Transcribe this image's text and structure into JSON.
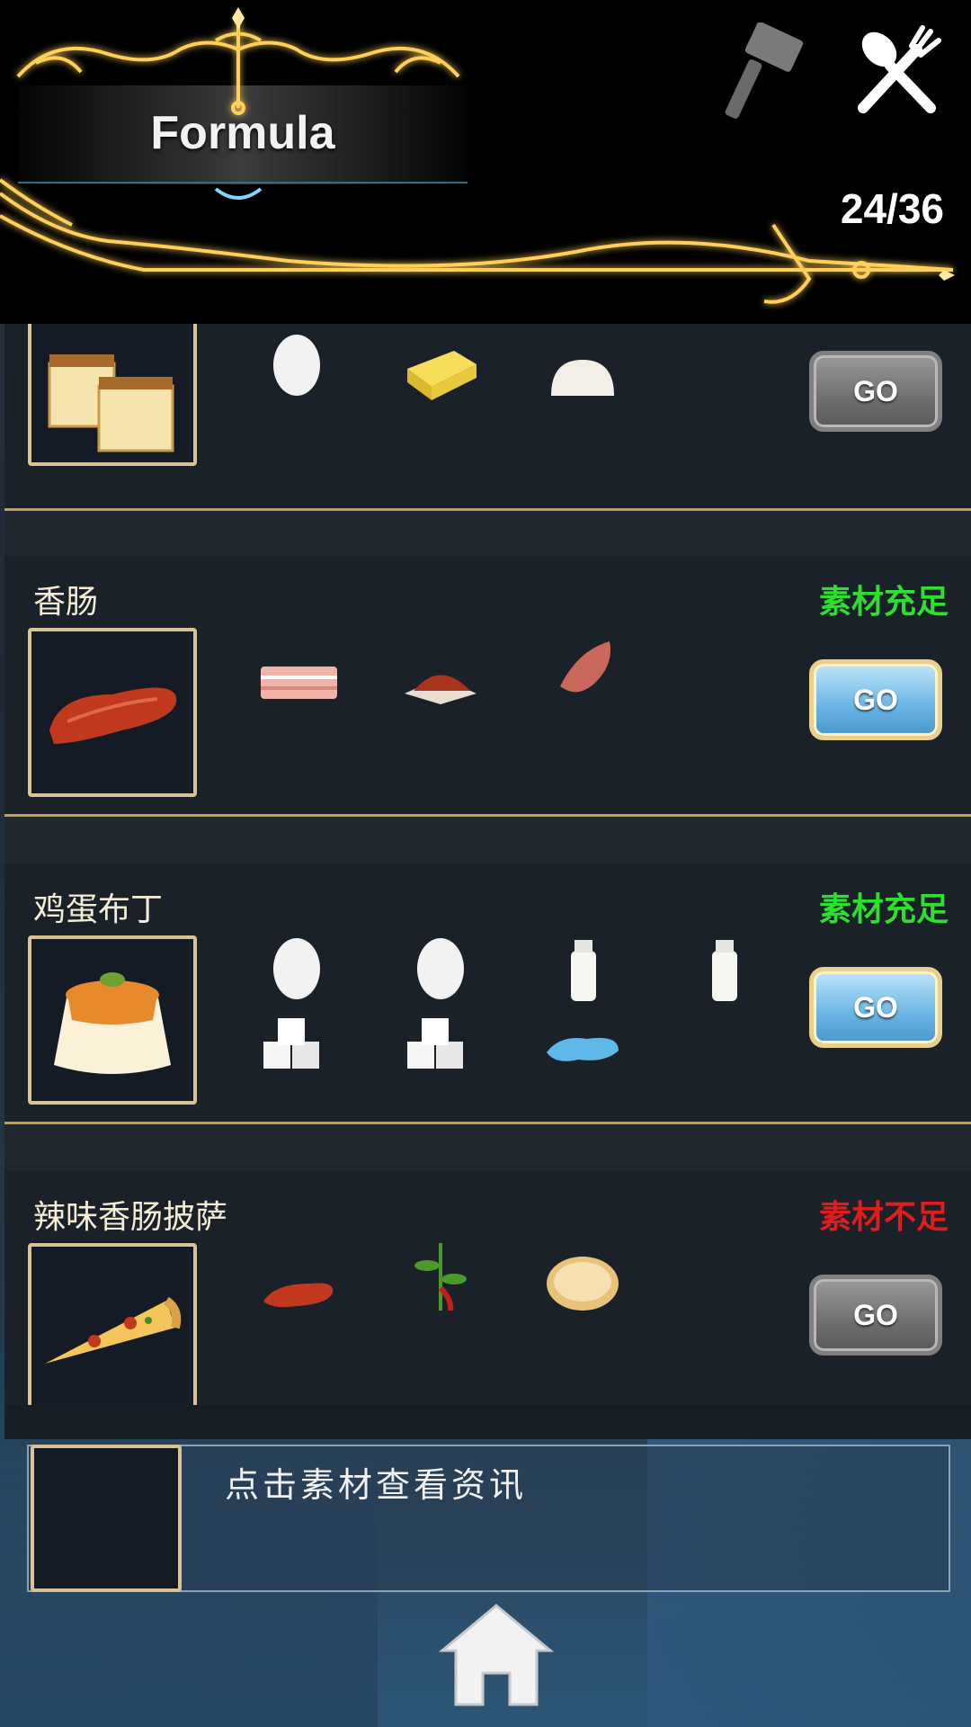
{
  "header": {
    "title": "Formula",
    "counter": "24/36",
    "tools": [
      {
        "icon": "hammer-icon",
        "active": false
      },
      {
        "icon": "fork-spoon-icon",
        "active": true
      }
    ]
  },
  "recipes": [
    {
      "name": "",
      "status": "",
      "thumbnail": "castella-cake",
      "ingredients": [
        "egg",
        "butter",
        "dough"
      ],
      "go_label": "GO",
      "go_style": "grey"
    },
    {
      "name": "香肠",
      "status": "素材充足",
      "status_ok": true,
      "thumbnail": "sausage",
      "ingredients": [
        "bacon",
        "chili-powder",
        "raw-meat"
      ],
      "go_label": "GO",
      "go_style": "blue"
    },
    {
      "name": "鸡蛋布丁",
      "status": "素材充足",
      "status_ok": true,
      "thumbnail": "egg-pudding",
      "ingredients": [
        "egg",
        "egg",
        "milk",
        "milk",
        "sugar-cubes",
        "sugar-cubes",
        "water"
      ],
      "go_label": "GO",
      "go_style": "blue"
    },
    {
      "name": "辣味香肠披萨",
      "status": "素材不足",
      "status_ok": false,
      "thumbnail": "pizza-slice",
      "ingredients": [
        "sausage",
        "chili-pepper",
        "pizza-crust"
      ],
      "go_label": "GO",
      "go_style": "grey"
    }
  ],
  "info": {
    "hint": "点击素材查看资讯"
  },
  "footer": {
    "home_icon": "home-icon"
  },
  "colors": {
    "status_ok": "#2ee02e",
    "status_bad": "#e01c1c",
    "gold": "#c9a04a"
  }
}
